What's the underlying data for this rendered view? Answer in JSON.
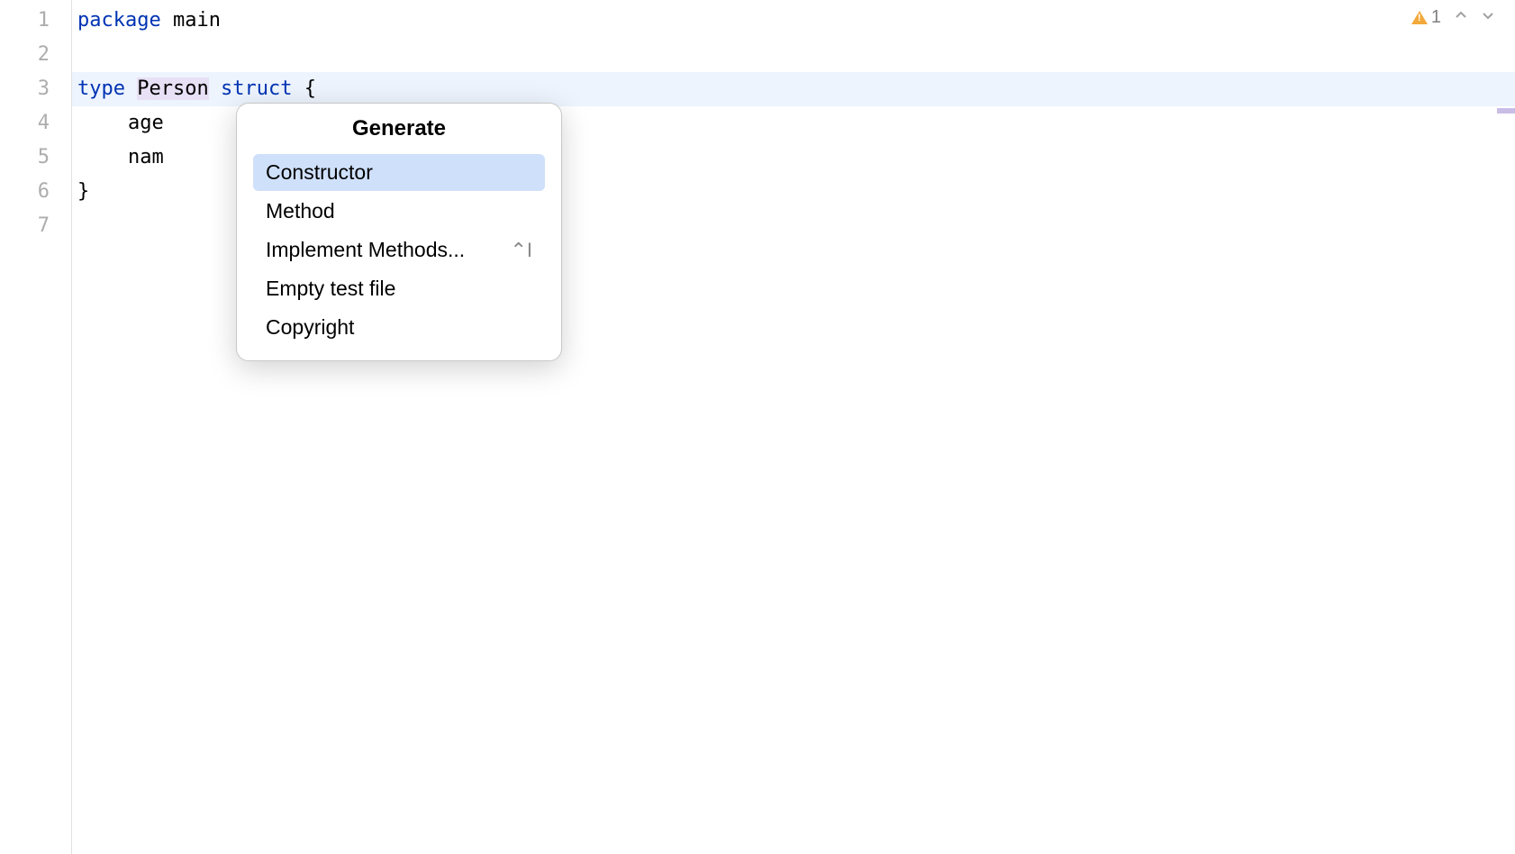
{
  "editor": {
    "line_numbers": [
      "1",
      "2",
      "3",
      "4",
      "5",
      "6",
      "7"
    ],
    "code": {
      "line1_kw": "package",
      "line1_ident": "main",
      "line3_kw1": "type",
      "line3_type": "Person",
      "line3_kw2": "struct",
      "line3_brace": "{",
      "line4_field": "age",
      "line5_field": "nam",
      "line6_brace": "}"
    }
  },
  "status": {
    "warning_count": "1"
  },
  "popup": {
    "title": "Generate",
    "items": [
      {
        "label": "Constructor",
        "shortcut": "",
        "selected": true
      },
      {
        "label": "Method",
        "shortcut": "",
        "selected": false
      },
      {
        "label": "Implement Methods...",
        "shortcut": "⌃I",
        "selected": false
      },
      {
        "label": "Empty test file",
        "shortcut": "",
        "selected": false
      },
      {
        "label": "Copyright",
        "shortcut": "",
        "selected": false
      }
    ]
  }
}
